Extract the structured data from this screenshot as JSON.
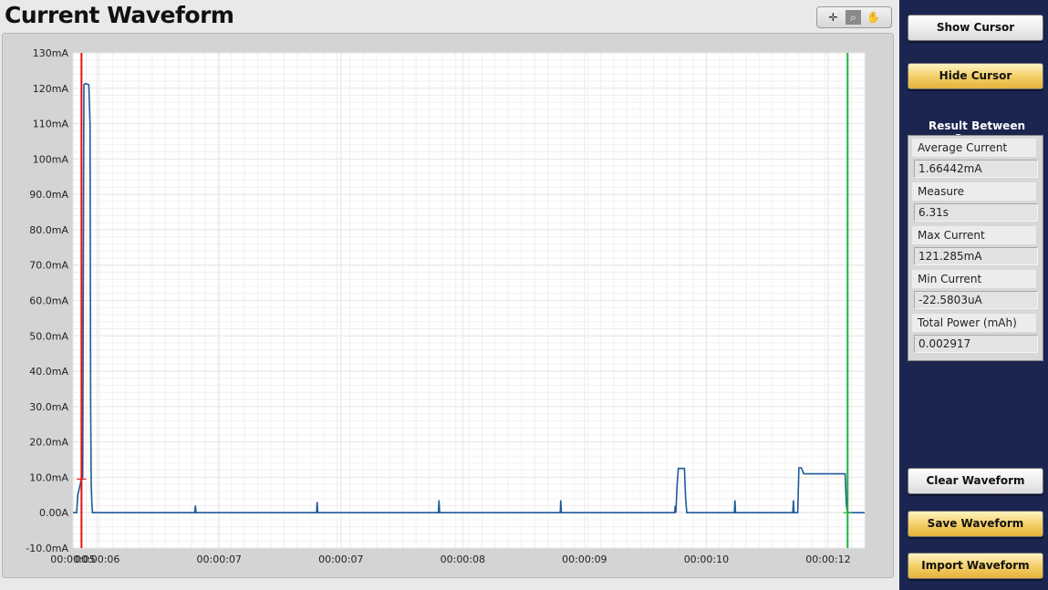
{
  "window": {
    "title": "Current Waveform"
  },
  "toolbar": {
    "tools": [
      "cursor-tool",
      "zoom-tool",
      "pan-tool"
    ]
  },
  "sidebar": {
    "show_cursor": "Show Cursor",
    "hide_cursor": "Hide Cursor",
    "results_title": "Result Between Cursors",
    "results": [
      {
        "label": "Average Current",
        "value": "1.66442mA"
      },
      {
        "label": "Measure",
        "value": "6.31s"
      },
      {
        "label": "Max Current",
        "value": "121.285mA"
      },
      {
        "label": "Min Current",
        "value": "-22.5803uA"
      },
      {
        "label": "Total Power (mAh)",
        "value": "0.002917"
      }
    ],
    "clear_waveform": "Clear Waveform",
    "save_waveform": "Save Waveform",
    "import_waveform": "Import Waveform"
  },
  "colors": {
    "series": "#1f5a9a",
    "cursor1": "#e81010",
    "cursor2": "#19b23a",
    "grid": "#e6e6e6",
    "gold": "#f3cd63"
  },
  "chart_data": {
    "type": "line",
    "xlabel": "",
    "ylabel": "",
    "xlim": [
      5.0,
      11.5
    ],
    "ylim": [
      -10,
      130
    ],
    "yticks": [
      -10,
      0,
      10,
      20,
      30,
      40,
      50,
      60,
      70,
      80,
      90,
      100,
      110,
      120,
      130
    ],
    "ytick_labels": [
      "-10.0mA",
      "0.00A",
      "10.0mA",
      "20.0mA",
      "30.0mA",
      "40.0mA",
      "50.0mA",
      "60.0mA",
      "70.0mA",
      "80.0mA",
      "90.0mA",
      "100mA",
      "110mA",
      "120mA",
      "130mA"
    ],
    "xticks": [
      5.0,
      5.2,
      6.2,
      7.2,
      8.2,
      9.2,
      10.2,
      11.2
    ],
    "xtick_labels": [
      "00:00:05",
      "00:00:06",
      "00:00:07",
      "00:00:07",
      "00:00:08",
      "00:00:09",
      "00:00:10",
      "00:00:12"
    ],
    "grid": true,
    "cursors": [
      {
        "name": "cursor-1",
        "x": 5.07,
        "y": 9.5,
        "color": "#e81010"
      },
      {
        "name": "cursor-2",
        "x": 11.36,
        "y": 0,
        "color": "#19b23a"
      }
    ],
    "series": [
      {
        "name": "",
        "x": [
          5.0,
          5.03,
          5.04,
          5.07,
          5.08,
          5.09,
          5.1,
          5.13,
          5.14,
          5.145,
          5.15,
          5.155,
          5.16,
          6.0,
          6.005,
          6.01,
          7.0,
          7.005,
          7.01,
          8.0,
          8.005,
          8.01,
          9.0,
          9.005,
          9.01,
          9.94,
          9.945,
          9.95,
          9.96,
          9.97,
          10.02,
          10.03,
          10.04,
          10.05,
          10.06,
          10.43,
          10.435,
          10.44,
          10.91,
          10.915,
          10.92,
          10.95,
          10.96,
          10.98,
          11.0,
          11.34,
          11.35,
          11.36,
          11.5
        ],
        "y": [
          0,
          0,
          5,
          9.5,
          10,
          121,
          121.3,
          121,
          110,
          30,
          8,
          3,
          0,
          0,
          2,
          0,
          0,
          3,
          0,
          0,
          3.5,
          0,
          0,
          3.5,
          0,
          0,
          2,
          0,
          8,
          12.5,
          12.5,
          4,
          0,
          0,
          0,
          0,
          3.5,
          0,
          0,
          3.5,
          0,
          0,
          12.7,
          12.7,
          11,
          11,
          2,
          0,
          0
        ]
      }
    ]
  }
}
